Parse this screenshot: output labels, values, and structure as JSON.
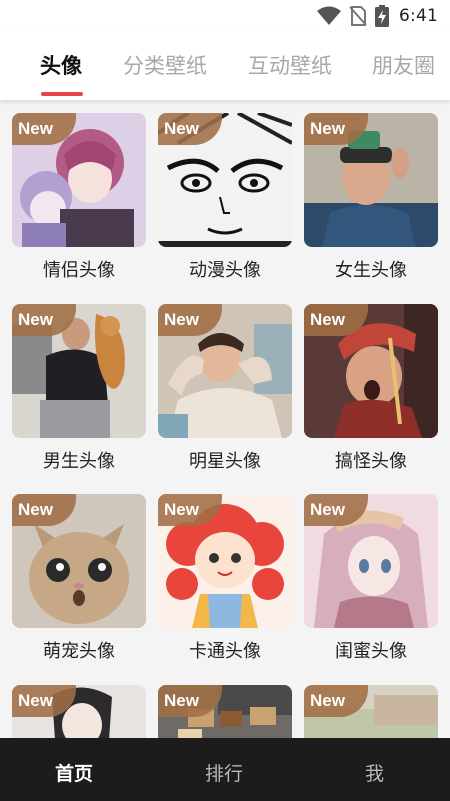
{
  "status_bar": {
    "time": "6:41",
    "icons": [
      "wifi-icon",
      "no-sim-icon",
      "battery-charging-icon"
    ]
  },
  "tabs": [
    {
      "label": "头像",
      "active": true
    },
    {
      "label": "分类壁纸",
      "active": false
    },
    {
      "label": "互动壁纸",
      "active": false
    },
    {
      "label": "朋友圈",
      "active": false
    }
  ],
  "badge_text": "New",
  "categories": [
    {
      "label": "情侣头像"
    },
    {
      "label": "动漫头像"
    },
    {
      "label": "女生头像"
    },
    {
      "label": "男生头像"
    },
    {
      "label": "明星头像"
    },
    {
      "label": "搞怪头像"
    },
    {
      "label": "萌宠头像"
    },
    {
      "label": "卡通头像"
    },
    {
      "label": "闺蜜头像"
    },
    {
      "label": ""
    },
    {
      "label": ""
    },
    {
      "label": ""
    }
  ],
  "bottom_nav": [
    {
      "label": "首页",
      "active": true
    },
    {
      "label": "排行",
      "active": false
    },
    {
      "label": "我",
      "active": false
    }
  ],
  "colors": {
    "accent": "#e8454a",
    "badge": "#a06e46",
    "bottom_nav_bg": "#1c1c1c"
  }
}
